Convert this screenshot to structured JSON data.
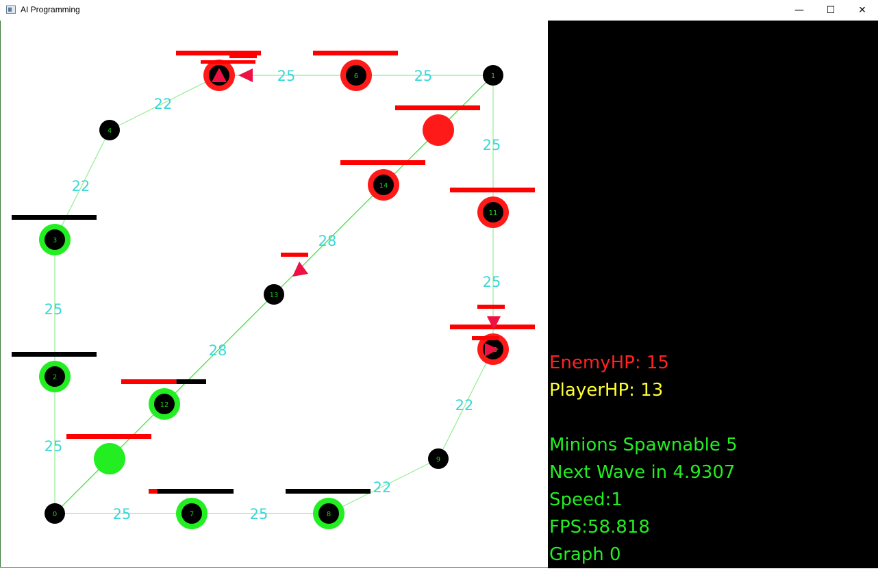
{
  "window": {
    "title": "AI Programming",
    "controls": {
      "minimize": "—",
      "maximize": "☐",
      "close": "✕"
    }
  },
  "colors": {
    "edge": "#90ee90",
    "edge_strong": "#33dd33",
    "weight_label": "#3dd6d6",
    "node_default": "#000000",
    "node_label": "#22cc22",
    "enemy_ring": "#ff1a1a",
    "player_ring": "#22ee22",
    "enemy_bar": "#ff0000",
    "player_bar": "#000000",
    "minion": "#ee1144",
    "enemy_hp_text": "#ff2222",
    "player_hp_text": "#ffff33",
    "info_text": "#22ee22"
  },
  "graph": {
    "nodes": [
      {
        "id": 0,
        "label": "0",
        "state": "plain"
      },
      {
        "id": 1,
        "label": "1",
        "state": "plain"
      },
      {
        "id": 2,
        "label": "2",
        "state": "player"
      },
      {
        "id": 3,
        "label": "3",
        "state": "player"
      },
      {
        "id": 4,
        "label": "4",
        "state": "plain"
      },
      {
        "id": 5,
        "label": "5",
        "state": "enemy"
      },
      {
        "id": 6,
        "label": "6",
        "state": "enemy"
      },
      {
        "id": 7,
        "label": "7",
        "state": "player"
      },
      {
        "id": 8,
        "label": "8",
        "state": "player"
      },
      {
        "id": 9,
        "label": "9",
        "state": "plain"
      },
      {
        "id": 10,
        "label": "10",
        "state": "enemy"
      },
      {
        "id": 11,
        "label": "11",
        "state": "enemy"
      },
      {
        "id": 12,
        "label": "12",
        "state": "player"
      },
      {
        "id": 13,
        "label": "13",
        "state": "plain"
      },
      {
        "id": 14,
        "label": "14",
        "state": "enemy"
      }
    ],
    "edges": [
      {
        "from": 5,
        "to": 6,
        "weight": "25"
      },
      {
        "from": 6,
        "to": 1,
        "weight": "25"
      },
      {
        "from": 4,
        "to": 5,
        "weight": "22"
      },
      {
        "from": 1,
        "to": 11,
        "weight": "25"
      },
      {
        "from": 3,
        "to": 4,
        "weight": "22"
      },
      {
        "from": 1,
        "to": 14,
        "weight": ""
      },
      {
        "from": 14,
        "to": 13,
        "weight": "28"
      },
      {
        "from": 11,
        "to": 10,
        "weight": "25"
      },
      {
        "from": 3,
        "to": 2,
        "weight": "25"
      },
      {
        "from": 13,
        "to": 12,
        "weight": "28"
      },
      {
        "from": 10,
        "to": 9,
        "weight": "22"
      },
      {
        "from": 2,
        "to": 0,
        "weight": "25"
      },
      {
        "from": 12,
        "to": 0,
        "weight": ""
      },
      {
        "from": 9,
        "to": 8,
        "weight": "22"
      },
      {
        "from": 0,
        "to": 7,
        "weight": "25"
      },
      {
        "from": 7,
        "to": 8,
        "weight": "25"
      }
    ],
    "health": [
      {
        "node": 5,
        "side": "enemy",
        "fraction": 1.0
      },
      {
        "node": 6,
        "side": "enemy",
        "fraction": 1.0
      },
      {
        "node": 11,
        "side": "enemy",
        "fraction": 1.0
      },
      {
        "node": 14,
        "side": "enemy",
        "fraction": 1.0
      },
      {
        "node": 10,
        "side": "enemy",
        "fraction": 1.0
      },
      {
        "node": 3,
        "side": "player",
        "fraction": 1.0
      },
      {
        "node": 2,
        "side": "player",
        "fraction": 1.0
      },
      {
        "node": 12,
        "side": "mixed",
        "fraction": 0.65
      },
      {
        "node": 7,
        "side": "mixed",
        "fraction": 0.1
      },
      {
        "node": 8,
        "side": "player",
        "fraction": 1.0
      }
    ],
    "units": [
      {
        "side": "enemy",
        "health": 1.0
      },
      {
        "side": "player",
        "health": 1.0
      }
    ],
    "minions": [
      {
        "id": "m1",
        "direction": "up"
      },
      {
        "id": "m2",
        "direction": "left"
      },
      {
        "id": "m3",
        "direction": "down-right"
      },
      {
        "id": "m4",
        "direction": "down"
      },
      {
        "id": "m5",
        "direction": "right"
      }
    ]
  },
  "hud": {
    "enemy_hp": "EnemyHP: 15",
    "player_hp": "PlayerHP: 13",
    "minions_spawnable": "Minions Spawnable 5",
    "next_wave": "Next Wave in 4.9307",
    "speed": "Speed:1",
    "fps": "FPS:58.818",
    "graph": "Graph 0"
  }
}
